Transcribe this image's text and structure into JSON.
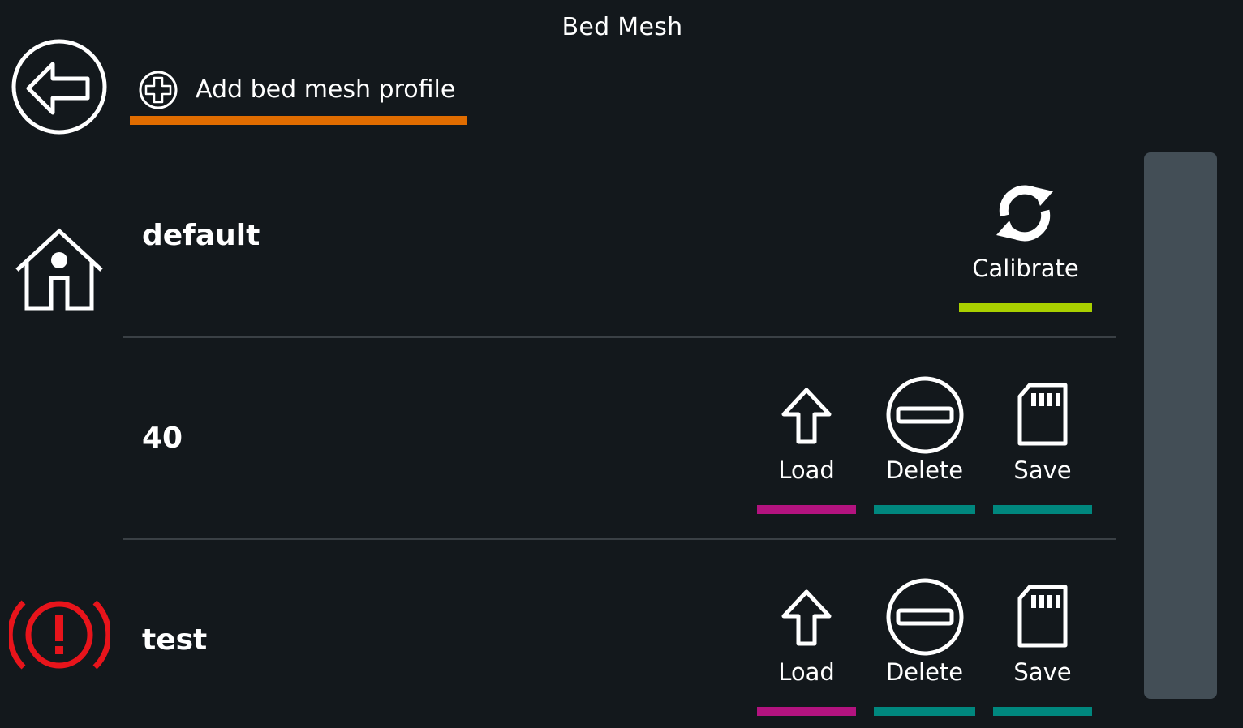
{
  "header": {
    "title": "Bed Mesh"
  },
  "sidebar": {
    "back_icon": "back-arrow-icon",
    "home_icon": "home-icon",
    "emergency_icon": "emergency-stop-icon"
  },
  "add_profile": {
    "label": "Add bed mesh profile",
    "icon": "plus-circle-icon"
  },
  "profiles": [
    {
      "name": "default",
      "actions": [
        {
          "label": "Calibrate",
          "icon": "refresh-icon"
        }
      ]
    },
    {
      "name": "40",
      "actions": [
        {
          "label": "Load",
          "icon": "load-arrow-icon"
        },
        {
          "label": "Delete",
          "icon": "delete-icon"
        },
        {
          "label": "Save",
          "icon": "sd-card-icon"
        }
      ]
    },
    {
      "name": "test",
      "actions": [
        {
          "label": "Load",
          "icon": "load-arrow-icon"
        },
        {
          "label": "Delete",
          "icon": "delete-icon"
        },
        {
          "label": "Save",
          "icon": "sd-card-icon"
        }
      ]
    }
  ],
  "colors": {
    "background": "#13181c",
    "add_accent": "#e06c00",
    "calibrate_accent": "#a9d000",
    "load_accent": "#b3137f",
    "delete_accent": "#00877e",
    "save_accent": "#00877e",
    "emergency": "#e8141b",
    "scrollbar": "#434e56"
  }
}
